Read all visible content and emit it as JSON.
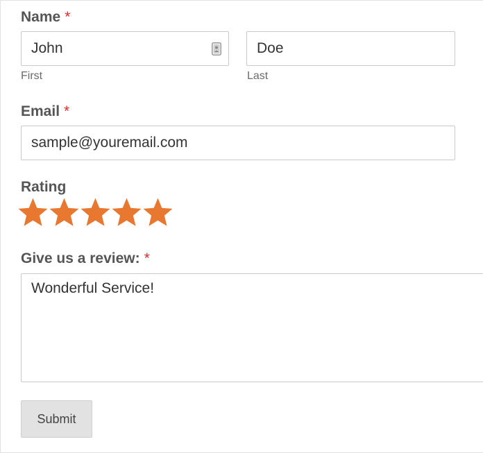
{
  "form": {
    "name": {
      "label": "Name",
      "required_mark": "*",
      "first": {
        "value": "John",
        "sublabel": "First"
      },
      "last": {
        "value": "Doe",
        "sublabel": "Last"
      }
    },
    "email": {
      "label": "Email",
      "required_mark": "*",
      "value": "sample@youremail.com"
    },
    "rating": {
      "label": "Rating",
      "value": 5,
      "max": 5,
      "star_color": "#e8782f"
    },
    "review": {
      "label": "Give us a review:",
      "required_mark": "*",
      "value": "Wonderful Service!"
    },
    "submit_label": "Submit"
  },
  "colors": {
    "required": "#e02b2b",
    "label": "#555555",
    "button_bg": "#e2e2e2"
  }
}
